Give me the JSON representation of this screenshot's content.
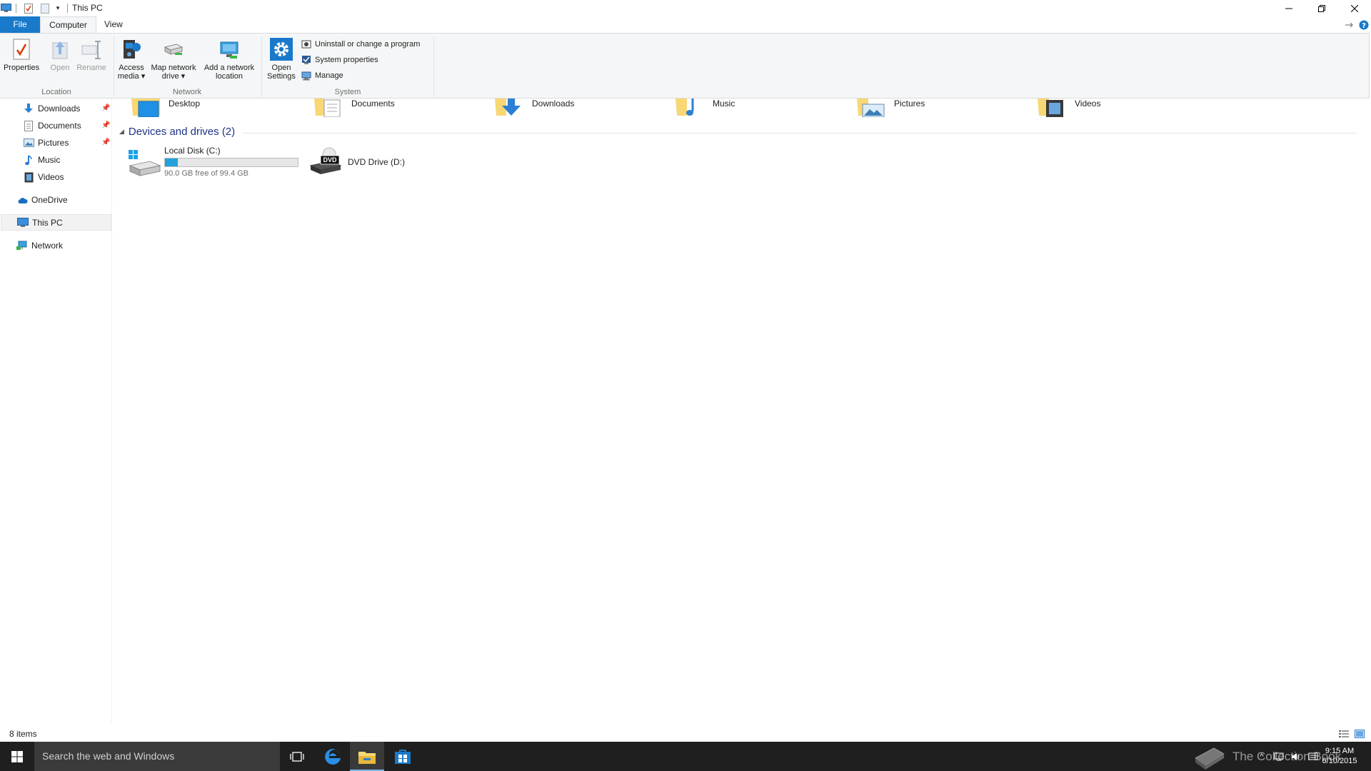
{
  "window": {
    "title": "This PC",
    "quick_access_tooltip": "Customize Quick Access Toolbar"
  },
  "tabs": [
    {
      "label": "File"
    },
    {
      "label": "Computer"
    },
    {
      "label": "View"
    }
  ],
  "ribbon": {
    "location": {
      "label": "Location",
      "properties": "Properties",
      "open": "Open",
      "rename": "Rename"
    },
    "network": {
      "label": "Network",
      "access_media_1": "Access",
      "access_media_2": "media",
      "map_drive_1": "Map network",
      "map_drive_2": "drive",
      "add_location_1": "Add a network",
      "add_location_2": "location"
    },
    "system": {
      "label": "System",
      "open_settings_1": "Open",
      "open_settings_2": "Settings",
      "uninstall": "Uninstall or change a program",
      "system_properties": "System properties",
      "manage": "Manage"
    }
  },
  "nav": {
    "items": [
      {
        "label": "Downloads",
        "pinned": true
      },
      {
        "label": "Documents",
        "pinned": true
      },
      {
        "label": "Pictures",
        "pinned": true
      },
      {
        "label": "Music"
      },
      {
        "label": "Videos"
      },
      {
        "label": "OneDrive"
      },
      {
        "label": "This PC",
        "selected": true
      },
      {
        "label": "Network"
      }
    ]
  },
  "folders": [
    {
      "label": "Desktop"
    },
    {
      "label": "Documents"
    },
    {
      "label": "Downloads"
    },
    {
      "label": "Music"
    },
    {
      "label": "Pictures"
    },
    {
      "label": "Videos"
    }
  ],
  "devices": {
    "heading": "Devices and drives (2)",
    "drives": [
      {
        "label": "Local Disk (C:)",
        "space": "90.0 GB free of 99.4 GB",
        "used_fraction": 0.095
      },
      {
        "label": "DVD Drive (D:)",
        "badge": "DVD"
      }
    ]
  },
  "status": {
    "count": "8 items"
  },
  "taskbar": {
    "search_placeholder": "Search the web and Windows",
    "watermark": "The Collection Book",
    "time": "9:15 AM",
    "date": "6/10/2015"
  },
  "colors": {
    "accent": "#1979ca",
    "heading": "#1e3287",
    "folder": "#f8d775",
    "drive_bar": "#26a0da",
    "taskbar": "#1f1f1f"
  }
}
